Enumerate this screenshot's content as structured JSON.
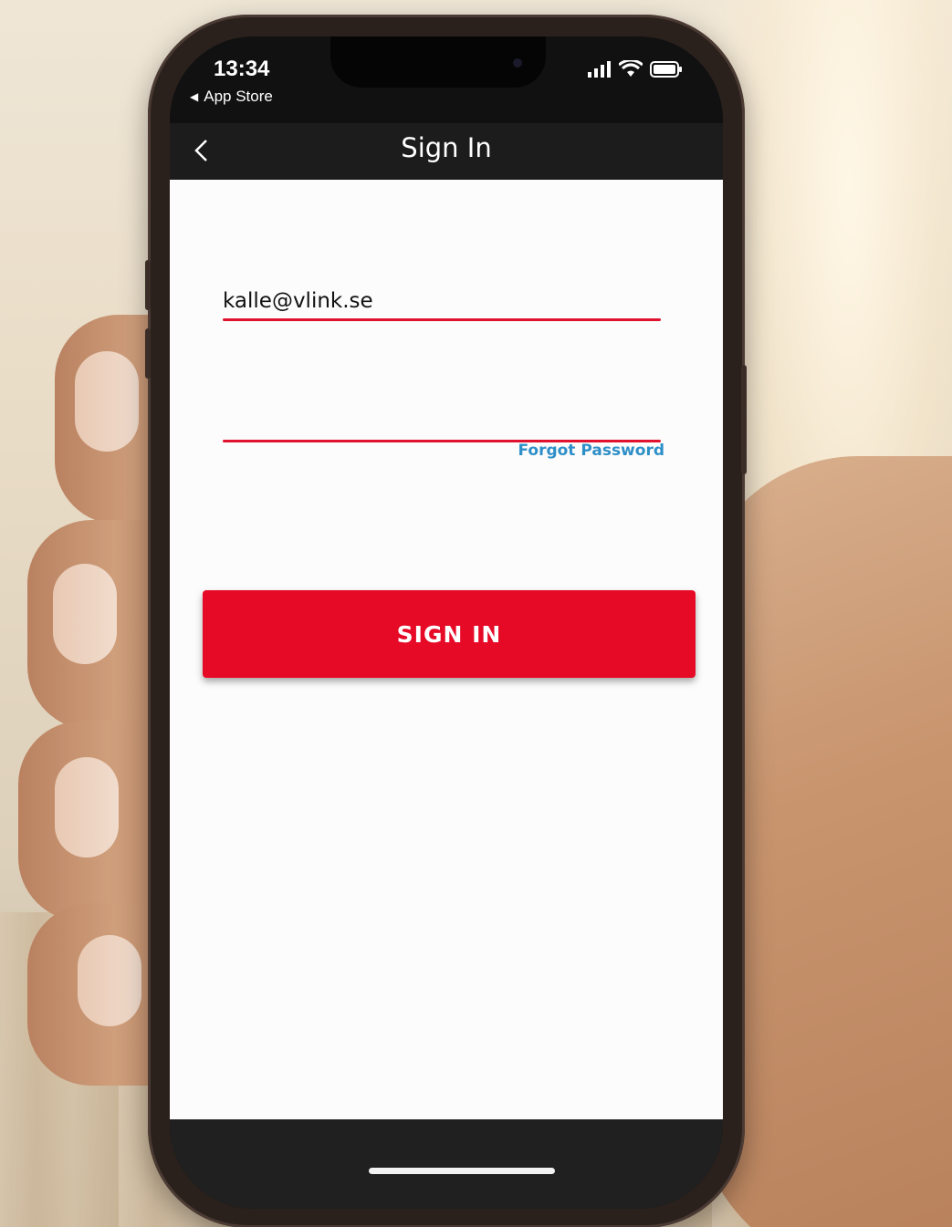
{
  "status_bar": {
    "time": "13:34",
    "back_app": "App Store"
  },
  "nav": {
    "title": "Sign In"
  },
  "form": {
    "email_value": "kalle@vlink.se",
    "password_value": "",
    "forgot_password_label": "Forgot Password",
    "signin_button_label": "SIGN IN"
  },
  "colors": {
    "accent_red": "#e60a27",
    "link_blue": "#2e8fc8",
    "navbar": "#1c1c1c"
  }
}
